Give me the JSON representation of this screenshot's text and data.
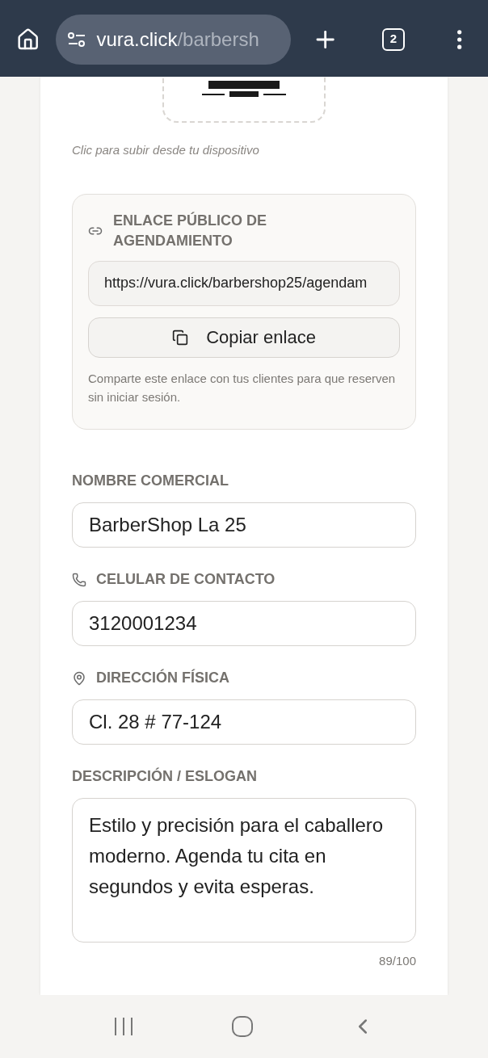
{
  "browser": {
    "url_host": "vura.click",
    "url_path": "/barbersh",
    "tab_count": "2"
  },
  "logo_upload": {
    "kind": "picture",
    "caption": "Clic para subir desde tu dispositivo"
  },
  "public_link": {
    "title": "ENLACE PÚBLICO DE AGENDAMIENTO",
    "url": "https://vura.click/barbershop25/agendam",
    "copy_button": "Copiar enlace",
    "help": "Comparte este enlace con tus clientes para que reserven sin iniciar sesión."
  },
  "fields": [
    {
      "kind": "plain",
      "label": "NOMBRE COMERCIAL",
      "value": "BarberShop La 25"
    },
    {
      "kind": "phone",
      "label": "CELULAR DE CONTACTO",
      "value": "3120001234"
    },
    {
      "kind": "location",
      "label": "DIRECCIÓN FÍSICA",
      "value": "Cl. 28 # 77-124"
    },
    {
      "kind": "textarea",
      "label": "DESCRIPCIÓN / ESLOGAN",
      "value": "Estilo y precisión para el caballero moderno. Agenda tu cita en segundos y evita esperas.",
      "counter": "89/100"
    }
  ]
}
